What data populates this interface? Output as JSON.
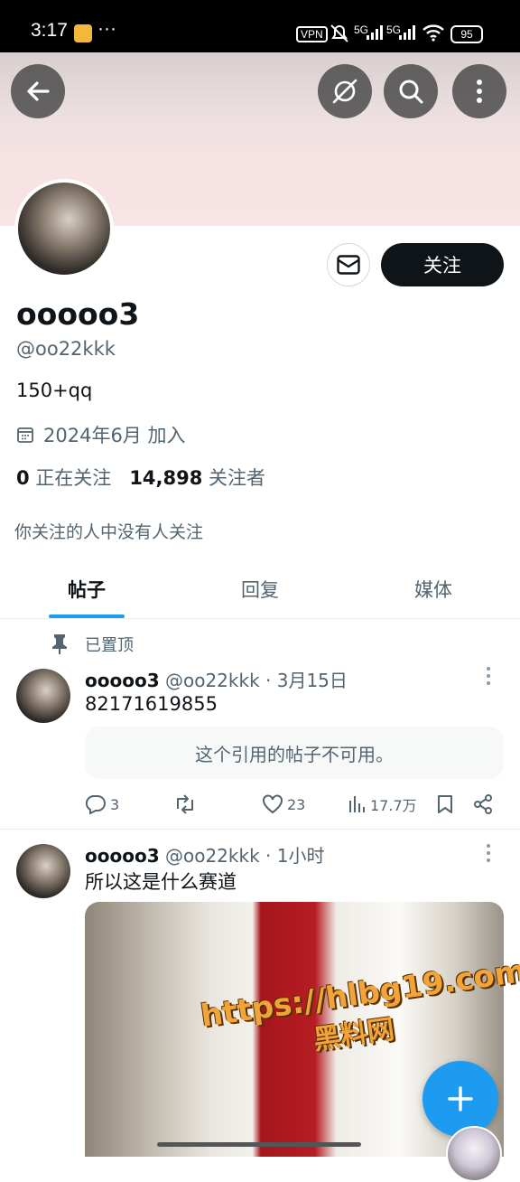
{
  "status_bar": {
    "time": "3:17",
    "dots": "···",
    "vpn": "VPN",
    "signal1": "5G",
    "signal2": "5G",
    "battery": "95"
  },
  "profile": {
    "name": "ooooo3",
    "handle": "@oo22kkk",
    "bio": "150+qq",
    "joined": "2024年6月 加入",
    "following_count": "0",
    "following_label": "正在关注",
    "followers_count": "14,898",
    "followers_label": "关注者",
    "mutual_note": "你关注的人中没有人关注",
    "follow_label": "关注"
  },
  "tabs": [
    {
      "label": "帖子",
      "active": true
    },
    {
      "label": "回复",
      "active": false
    },
    {
      "label": "媒体",
      "active": false
    }
  ],
  "posts": [
    {
      "pinned_label": "已置顶",
      "name": "ooooo3",
      "handle": "@oo22kkk",
      "separator": "·",
      "time": "3月15日",
      "text": "82171619855",
      "quote": "这个引用的帖子不可用。",
      "replies": "3",
      "reposts": "",
      "likes": "23",
      "views": "17.7万"
    },
    {
      "name": "ooooo3",
      "handle": "@oo22kkk",
      "separator": "·",
      "time": "1小时",
      "text": "所以这是什么赛道"
    }
  ],
  "watermark": {
    "line1": "https://hlbg19.com",
    "line2": "黑料网"
  },
  "colors": {
    "accent": "#1d9bf0",
    "banner": "#f6e2e3",
    "follow_button": "#0f1419"
  }
}
